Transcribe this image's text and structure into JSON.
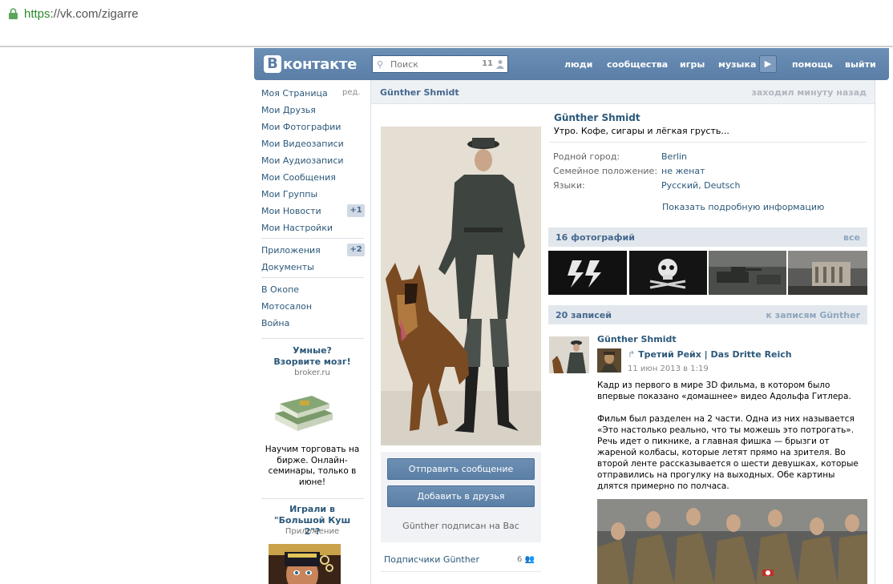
{
  "browser": {
    "url_scheme": "https",
    "url_rest": "://vk.com/zigarre"
  },
  "header": {
    "logo_letter": "В",
    "logo_text": "контакте",
    "search_placeholder": "Поиск",
    "search_count": "11",
    "nav": [
      "люди",
      "сообщества",
      "игры",
      "музыка",
      "помощь",
      "выйти"
    ],
    "play_icon": "▶",
    "brand_color": "#5a7ea6"
  },
  "left_menu": {
    "items": [
      "Моя Страница",
      "Мои Друзья",
      "Мои Фотографии",
      "Мои Видеозаписи",
      "Мои Аудиозаписи",
      "Мои Сообщения",
      "Мои Группы",
      "Мои Новости",
      "Мои Настройки"
    ],
    "edit_label": "ред.",
    "news_badge": "+1",
    "apps": [
      "Приложения",
      "Документы"
    ],
    "apps_badge": "+2",
    "groups": [
      "В Окопе",
      "Мотосалон",
      "Война"
    ]
  },
  "ads": [
    {
      "title": "Умные? Взорвите мозг!",
      "sub": "broker.ru",
      "text": "Научим торговать на бирже. Онлайн-семинары, только в июне!"
    },
    {
      "title": "Играли в \"Большой Куш 2\"?",
      "sub": "Приложение"
    }
  ],
  "profile": {
    "header_name": "Günther Shmidt",
    "last_seen": "заходил минуту назад",
    "name": "Günther Shmidt",
    "status": "Утро. Кофе, сигары и лёгкая грусть...",
    "info": [
      {
        "label": "Родной город:",
        "value": "Berlin"
      },
      {
        "label": "Семейное положение:",
        "value": "не женат"
      },
      {
        "label": "Языки:",
        "value": "Русский, Deutsch"
      }
    ],
    "show_more": "Показать подробную информацию",
    "send_message": "Отправить сообщение",
    "add_friend": "Добавить в друзья",
    "subscribed_note": "Günther подписан на Вас",
    "subscribers_label": "Подписчики Günther",
    "subscribers_count": "6"
  },
  "photos": {
    "title": "16 фотографий",
    "all_label": "все"
  },
  "wall": {
    "title": "20 записей",
    "link": "к записям Günther",
    "post": {
      "author": "Günther Shmidt",
      "repost_source": "Третий Рейх | Das Dritte Reich",
      "date": "11 июн 2013 в 1:19",
      "paragraphs": [
        "Кадр из первого в мире 3D фильма, в котором было впервые показано «домашнее» видео Адольфа Гитлера.",
        "Фильм был разделен на 2 части. Одна из них называется «Это настолько реально, что ты можешь это потрогать». Речь идет о пикнике, а главная фишка — брызги от жареной колбасы, которые летят прямо на зрителя. Во второй ленте рассказывается о шести девушках, которые отправились на прогулку на выходных. Обе картины длятся примерно по полчаса."
      ]
    }
  }
}
